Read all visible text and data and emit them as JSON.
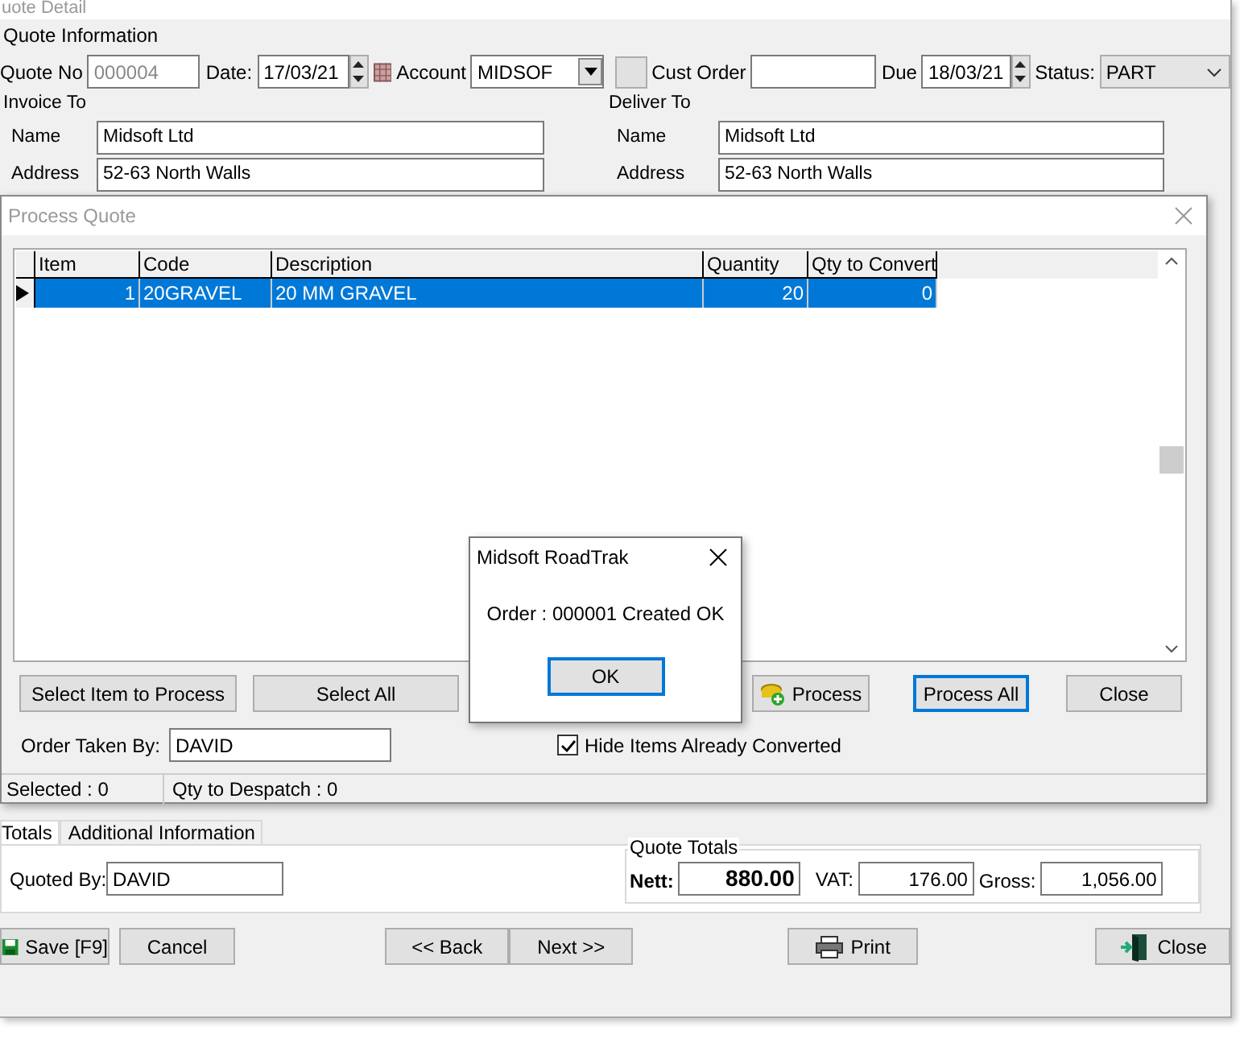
{
  "main_window": {
    "title": "uote Detail",
    "quote_information": {
      "label": "Quote Information",
      "quote_no_label": "Quote No",
      "quote_no": "000004",
      "date_label": "Date:",
      "date": "17/03/21",
      "account_label": "Account",
      "account": "MIDSOF",
      "cust_order_label": "Cust Order",
      "due_label": "Due",
      "due": "18/03/21",
      "status_label": "Status:",
      "status": "PART"
    },
    "invoice_to": {
      "label": "Invoice To",
      "name_label": "Name",
      "name": "Midsoft Ltd",
      "address_label": "Address",
      "address": "52-63 North Walls"
    },
    "deliver_to": {
      "label": "Deliver To",
      "name_label": "Name",
      "name": "Midsoft Ltd",
      "address_label": "Address",
      "address": "52-63 North Walls"
    },
    "tabs": [
      {
        "label": "Totals",
        "selected": true
      },
      {
        "label": "Additional Information",
        "selected": false
      }
    ],
    "quoted_by_label": "Quoted By:",
    "quoted_by": "DAVID",
    "quote_totals": {
      "label": "Quote Totals",
      "nett_label": "Nett:",
      "nett": "880.00",
      "vat_label": "VAT:",
      "vat": "176.00",
      "gross_label": "Gross:",
      "gross": "1,056.00"
    },
    "buttons": [
      {
        "label": "Save [F9]"
      },
      {
        "label": "Cancel"
      },
      {
        "label": "<< Back"
      },
      {
        "label": "Next >>"
      },
      {
        "label": "Print"
      },
      {
        "label": "Close"
      }
    ]
  },
  "process_quote": {
    "title": "Process Quote",
    "columns": [
      "Item",
      "Code",
      "Description",
      "Quantity",
      "Qty to Convert"
    ],
    "rows": [
      {
        "cells": [
          "1",
          "20GRAVEL",
          "20 MM GRAVEL",
          "20",
          "0"
        ],
        "selected": true
      }
    ],
    "buttons": [
      {
        "label": "Select Item to Process",
        "default": false
      },
      {
        "label": "Select All",
        "default": false
      },
      {
        "label": "Process",
        "default": false
      },
      {
        "label": "Process All",
        "default": true
      },
      {
        "label": "Close",
        "default": false
      }
    ],
    "order_taken_by_label": "Order Taken By:",
    "order_taken_by": "DAVID",
    "hide_converted": {
      "label": "Hide Items Already Converted",
      "checked": true
    },
    "status_bar": [
      "Selected : 0",
      "Qty to Despatch : 0"
    ]
  },
  "message_box": {
    "title": "Midsoft RoadTrak",
    "text": "Order : 000001 Created OK",
    "button": "OK"
  }
}
